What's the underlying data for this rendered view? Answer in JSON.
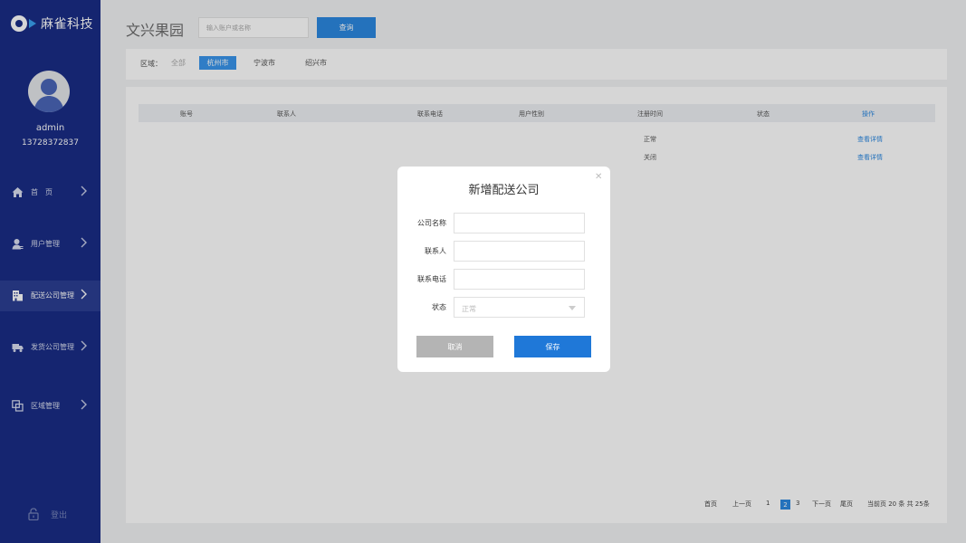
{
  "app": {
    "logo_text": "麻雀科技"
  },
  "user": {
    "name": "admin",
    "phone": "13728372837"
  },
  "sidebar": {
    "items": [
      {
        "label": "首　页"
      },
      {
        "label": "用户管理"
      },
      {
        "label": "配送公司管理"
      },
      {
        "label": "发货公司管理"
      },
      {
        "label": "区域管理"
      }
    ],
    "logout_label": "登出"
  },
  "header": {
    "title": "文兴果园",
    "search_placeholder": "输入账户或名称",
    "query_label": "查询"
  },
  "region": {
    "label": "区域：",
    "options": [
      {
        "label": "全部"
      },
      {
        "label": "杭州市"
      },
      {
        "label": "宁波市"
      },
      {
        "label": "绍兴市"
      }
    ],
    "selected": "杭州市"
  },
  "table": {
    "columns": [
      "账号",
      "联系人",
      "联系电话",
      "用户性别",
      "注册时间",
      "状态",
      "操作"
    ],
    "rows": [
      {
        "status": "正常",
        "action": "查看详情"
      },
      {
        "status": "关闭",
        "action": "查看详情"
      }
    ]
  },
  "pagination": {
    "first": "首页",
    "prev": "上一页",
    "pages": [
      "1",
      "2",
      "3"
    ],
    "current": "2",
    "next": "下一页",
    "last": "尾页",
    "summary": "当前页 20 条 共 25条"
  },
  "modal": {
    "title": "新增配送公司",
    "fields": {
      "company_name_label": "公司名称",
      "contact_label": "联系人",
      "phone_label": "联系电话",
      "status_label": "状态",
      "status_value": "正常"
    },
    "cancel_label": "取消",
    "save_label": "保存"
  },
  "colors": {
    "sidebar_bg": "#1a2d86",
    "accent": "#2b88e0",
    "cancel_bg": "#b4b4b4"
  }
}
